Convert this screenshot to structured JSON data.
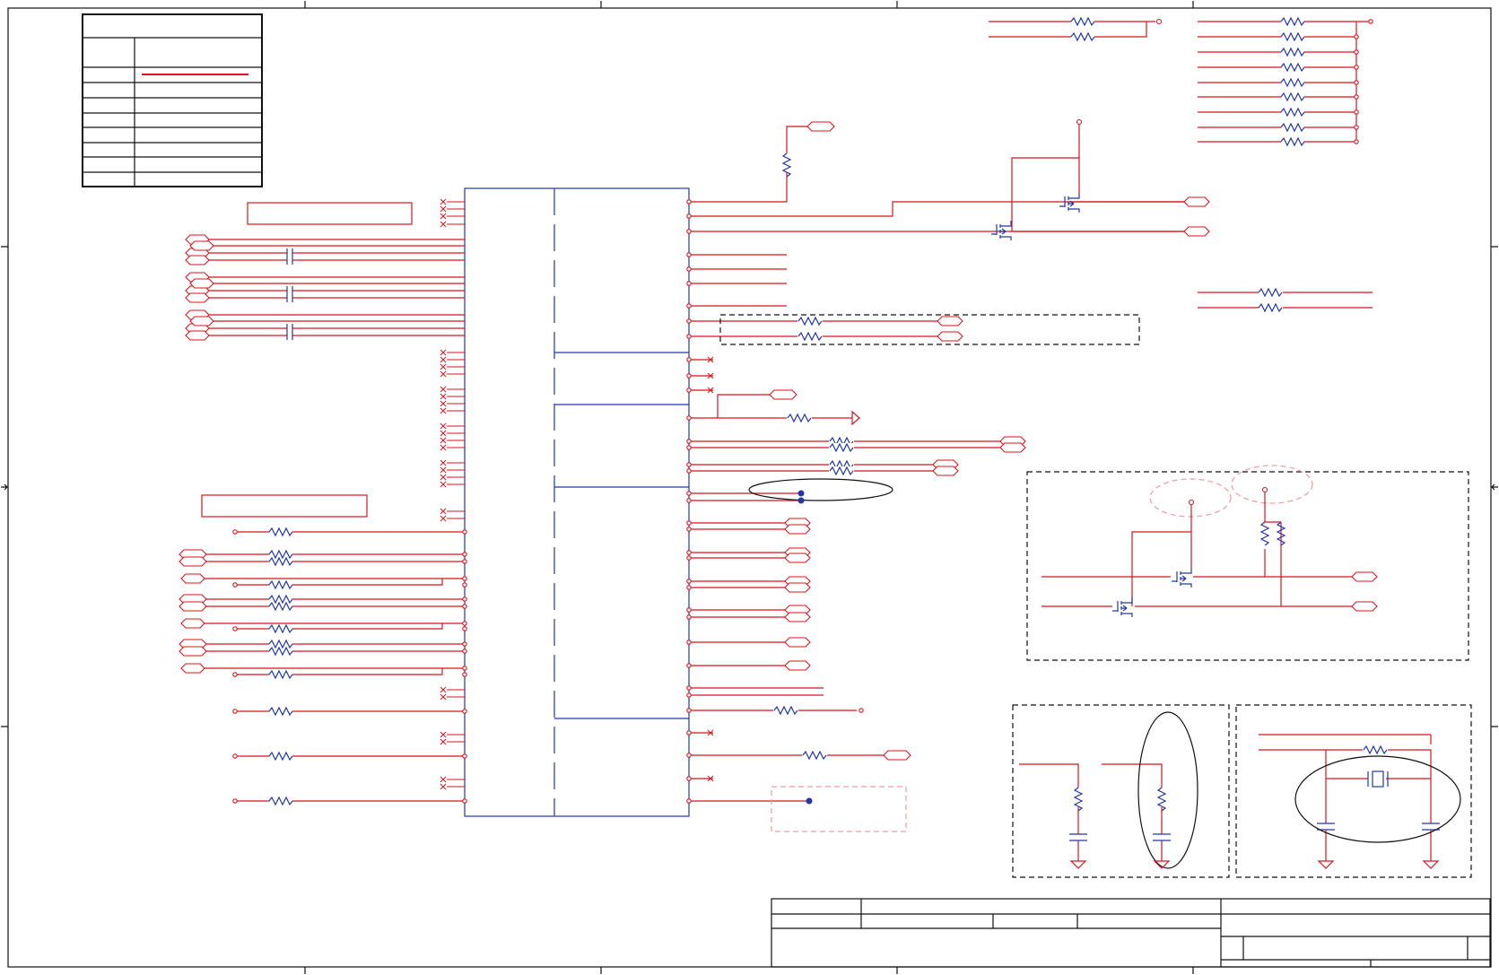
{
  "colors": {
    "wire": "#d8141e",
    "component": "#2337a6",
    "frame": "#111111",
    "dashed_region": "#111111",
    "note_region": "#f19aa0"
  },
  "sheet": {
    "title_block_text": [],
    "revision_table_rows": []
  }
}
